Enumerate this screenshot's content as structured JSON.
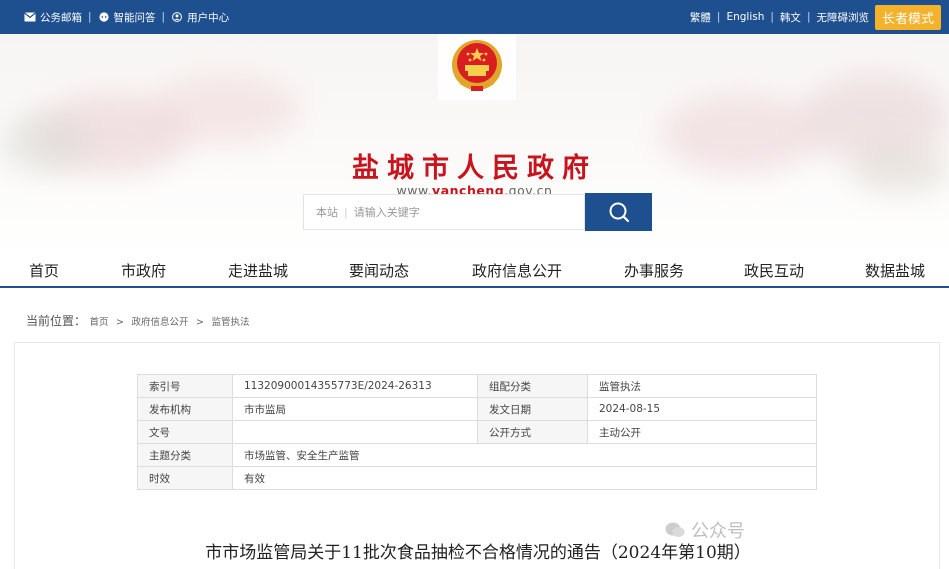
{
  "topbar": {
    "mail": "公务邮箱",
    "qa": "智能问答",
    "user": "用户中心",
    "traditional": "繁體",
    "english": "English",
    "korean": "韩文",
    "accessible": "无障碍浏览",
    "elder": "长者模式"
  },
  "banner": {
    "title": "盐城市人民政府",
    "url_prefix": "www.",
    "url_brand": "yancheng",
    "url_suffix": ".gov.cn"
  },
  "search": {
    "scope": "本站",
    "placeholder": "请输入关键字"
  },
  "nav": [
    "首页",
    "市政府",
    "走进盐城",
    "要闻动态",
    "政府信息公开",
    "办事服务",
    "政民互动",
    "数据盐城"
  ],
  "breadcrumb": {
    "label": "当前位置：",
    "items": [
      "首页",
      "政府信息公开",
      "监管执法"
    ]
  },
  "meta": {
    "index_label": "索引号",
    "index_value": "11320900014355773E/2024-26313",
    "category_label": "组配分类",
    "category_value": "监管执法",
    "publisher_label": "发布机构",
    "publisher_value": "市市监局",
    "date_label": "发文日期",
    "date_value": "2024-08-15",
    "docno_label": "文号",
    "docno_value": "",
    "open_label": "公开方式",
    "open_value": "主动公开",
    "topic_label": "主题分类",
    "topic_value": "市场监管、安全生产监管",
    "validity_label": "时效",
    "validity_value": "有效"
  },
  "doc_title": "市市场监管局关于11批次食品抽检不合格情况的通告（2024年第10期）",
  "watermark": "公众号",
  "colors": {
    "primary": "#1e4f8f",
    "title_red": "#c8141c",
    "elder_orange": "#f4b12a"
  }
}
